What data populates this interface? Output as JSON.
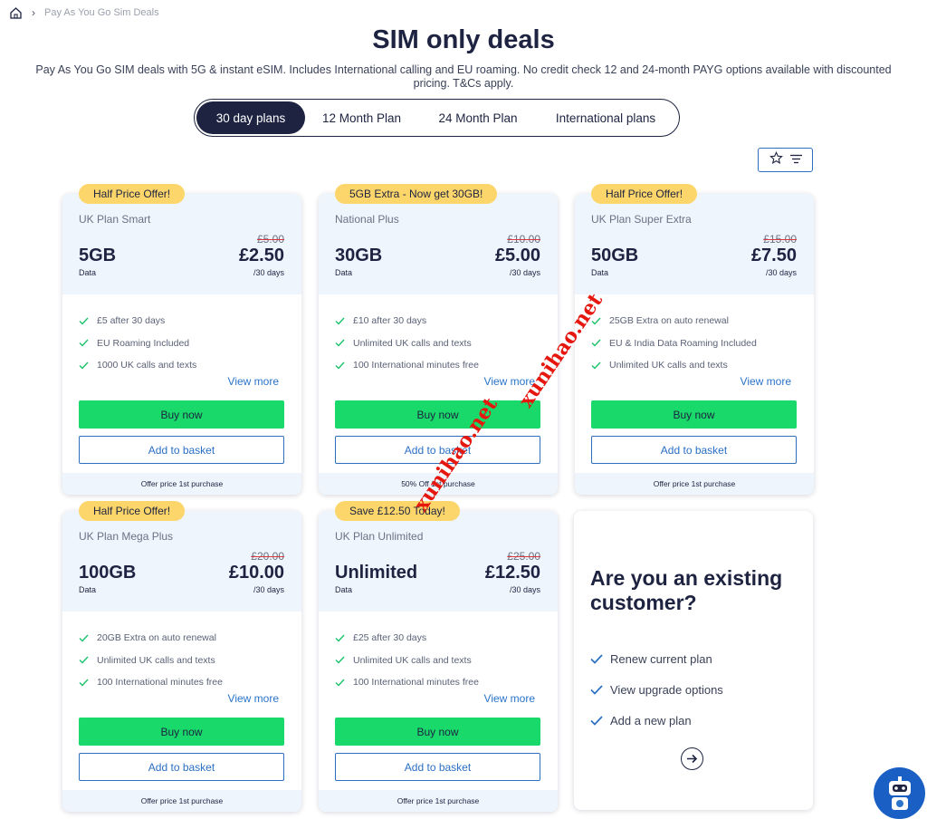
{
  "breadcrumb": {
    "home_icon": "home-icon",
    "separator_icon": "chevron-right-icon",
    "current": "Pay As You Go Sim Deals"
  },
  "header": {
    "title": "SIM only deals",
    "subtitle": "Pay As You Go SIM deals with 5G & instant eSIM. Includes International calling and EU roaming. No credit check 12 and 24-month PAYG options available with discounted pricing. T&Cs apply."
  },
  "tabs": [
    {
      "label": "30 day plans",
      "active": true
    },
    {
      "label": "12 Month Plan",
      "active": false
    },
    {
      "label": "24 Month Plan",
      "active": false
    },
    {
      "label": "International plans",
      "active": false
    }
  ],
  "filter": {
    "icons": [
      "star-icon",
      "filter-icon"
    ]
  },
  "plans": [
    {
      "badge": "Half Price Offer!",
      "name": "UK Plan Smart",
      "old_price": "£5.00",
      "data": "5GB",
      "data_label": "Data",
      "price": "£2.50",
      "period": "/30 days",
      "features": [
        "£5 after 30 days",
        "EU Roaming Included",
        "1000 UK calls and texts"
      ],
      "view_more": "View more",
      "buy": "Buy now",
      "basket": "Add to basket",
      "footer": "Offer price 1st purchase"
    },
    {
      "badge": "5GB Extra - Now get 30GB!",
      "name": "National Plus",
      "old_price": "£10.00",
      "data": "30GB",
      "data_label": "Data",
      "price": "£5.00",
      "period": "/30 days",
      "features": [
        "£10 after 30 days",
        "Unlimited UK calls and texts",
        "100 International minutes free"
      ],
      "view_more": "View more",
      "buy": "Buy now",
      "basket": "Add to basket",
      "footer": "50% Off 1st purchase"
    },
    {
      "badge": "Half Price Offer!",
      "name": "UK Plan Super Extra",
      "old_price": "£15.00",
      "data": "50GB",
      "data_label": "Data",
      "price": "£7.50",
      "period": "/30 days",
      "features": [
        "25GB Extra on auto renewal",
        "EU & India Data Roaming Included",
        "Unlimited UK calls and texts"
      ],
      "view_more": "View more",
      "buy": "Buy now",
      "basket": "Add to basket",
      "footer": "Offer price 1st purchase"
    },
    {
      "badge": "Half Price Offer!",
      "name": "UK Plan Mega Plus",
      "old_price": "£20.00",
      "data": "100GB",
      "data_label": "Data",
      "price": "£10.00",
      "period": "/30 days",
      "features": [
        "20GB Extra on auto renewal",
        "Unlimited UK calls and texts",
        "100 International minutes free"
      ],
      "view_more": "View more",
      "buy": "Buy now",
      "basket": "Add to basket",
      "footer": "Offer price 1st purchase"
    },
    {
      "badge": "Save £12.50 Today!",
      "name": "UK Plan Unlimited",
      "old_price": "£25.00",
      "data": "Unlimited",
      "data_label": "Data",
      "price": "£12.50",
      "period": "/30 days",
      "features": [
        "£25 after 30 days",
        "Unlimited UK calls and texts",
        "100 International minutes free"
      ],
      "view_more": "View more",
      "buy": "Buy now",
      "basket": "Add to basket",
      "footer": "Offer price 1st purchase"
    }
  ],
  "existing_customer": {
    "title": "Are you an existing customer?",
    "options": [
      "Renew current plan",
      "View upgrade options",
      "Add a new plan"
    ],
    "arrow_icon": "arrow-right-circle-icon"
  },
  "chat": {
    "icon": "chatbot-icon"
  },
  "watermark": {
    "text": "xunihao.net"
  },
  "colors": {
    "navy": "#1d2340",
    "green": "#19d96a",
    "badge": "#fcd66a",
    "link": "#2a74c9",
    "card_top": "#eef5fd"
  }
}
